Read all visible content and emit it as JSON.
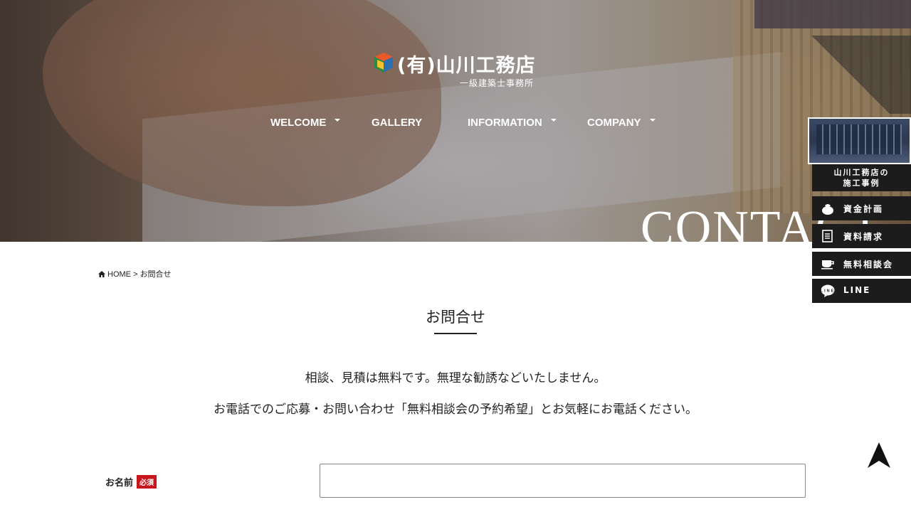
{
  "logo": {
    "name": "(有)山川工務店",
    "subtitle": "一級建築士事務所"
  },
  "nav": {
    "items": [
      {
        "label": "WELCOME",
        "dropdown": true
      },
      {
        "label": "GALLERY",
        "dropdown": false
      },
      {
        "label": "INFORMATION",
        "dropdown": true
      },
      {
        "label": "COMPANY",
        "dropdown": true
      }
    ]
  },
  "hero": {
    "title": "CONTACT"
  },
  "side_panel": {
    "caption": "山川工務店の\n施工事例",
    "buttons": [
      {
        "label": "資金計画",
        "icon": "money-bag-icon"
      },
      {
        "label": "資料請求",
        "icon": "document-icon"
      },
      {
        "label": "無料相談会",
        "icon": "coffee-cup-icon"
      },
      {
        "label": "LINE",
        "icon": "line-icon"
      }
    ]
  },
  "breadcrumb": {
    "home": "HOME",
    "separator": ">",
    "current": "お問合せ"
  },
  "page": {
    "title": "お問合せ",
    "intro_line1": "相談、見積は無料です。無理な勧誘などいたしません。",
    "intro_line2": "お電話でのご応募・お問い合わせ「無料相談会の予約希望」とお気軽にお電話ください。"
  },
  "form": {
    "name_label": "お名前",
    "required_badge": "必須",
    "name_value": ""
  },
  "colors": {
    "required_badge": "#c8161d",
    "side_panel_bg": "#1c1c1c",
    "text": "#222222"
  }
}
